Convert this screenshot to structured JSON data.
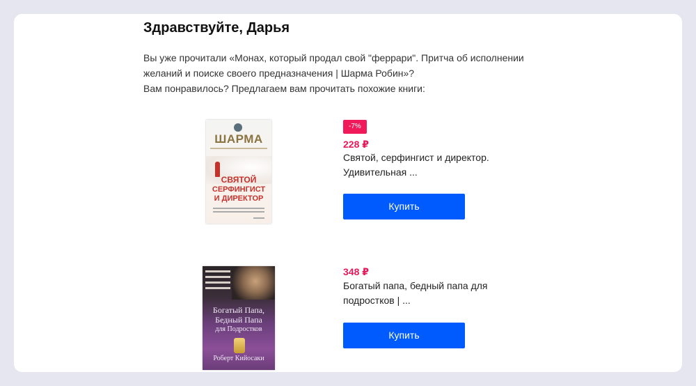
{
  "greeting": "Здравствуйте, Дарья",
  "intro": {
    "line1": "Вы уже прочитали «Монах, который продал свой \"феррари\". Притча об исполнении",
    "line2": "желаний и поиске своего предназначения | Шарма Робин»?",
    "line3": "Вам понравилось? Предлагаем вам прочитать похожие книги:"
  },
  "products": [
    {
      "discount": "-7%",
      "price": "228 ₽",
      "title_line1": "Святой, серфингист и директор.",
      "title_line2": "Удивительная ...",
      "buy_label": "Купить",
      "cover": {
        "author": "ШАРМА",
        "title_lines": [
          "СВЯТОЙ",
          "СЕРФИНГИСТ",
          "И ДИРЕКТОР"
        ],
        "accent": "#c7312c"
      }
    },
    {
      "price": "348 ₽",
      "title_line1": "Богатый папа, бедный папа для",
      "title_line2": "подростков | ...",
      "buy_label": "Купить",
      "cover": {
        "title_lines": [
          "Богатый Папа,",
          "Бедный Папа",
          "для Подростков"
        ],
        "author": "Роберт Кийосаки"
      }
    }
  ],
  "colors": {
    "background": "#e6e6f0",
    "price": "#e8195a",
    "badge": "#f0195a",
    "button": "#005bff"
  }
}
